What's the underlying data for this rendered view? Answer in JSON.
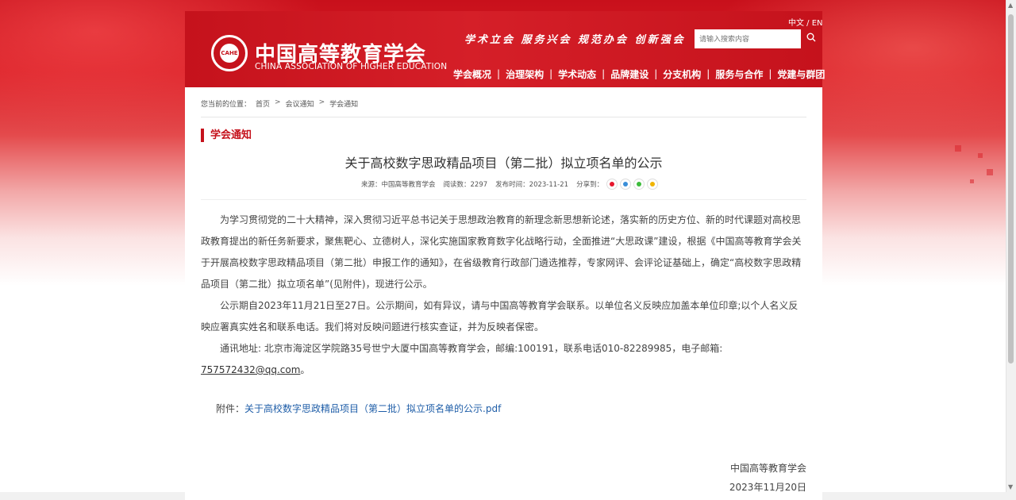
{
  "header": {
    "org_name_cn": "中国高等教育学会",
    "org_name_en": "CHINA ASSOCIATION OF HIGHER EDUCATION",
    "logo_text": "CAHE",
    "language_switch": "中文 / EN",
    "slogan": "学术立会 服务兴会 规范办会 创新强会",
    "search_placeholder": "请输入搜索内容",
    "nav": [
      "学会概况",
      "治理架构",
      "学术动态",
      "品牌建设",
      "分支机构",
      "服务与合作",
      "党建与群团"
    ]
  },
  "breadcrumb": {
    "label": "您当前的位置：",
    "items": [
      "首页",
      "会议通知",
      "学会通知"
    ]
  },
  "section_title": "学会通知",
  "article": {
    "title": "关于高校数字思政精品项目（第二批）拟立项名单的公示",
    "meta": {
      "source": "来源：中国高等教育学会",
      "views": "阅读数：2297",
      "date": "发布时间：2023-11-21",
      "share_label": "分享到："
    },
    "share_icons": [
      "weibo-icon",
      "qzone-icon",
      "wechat-icon",
      "favorite-icon"
    ],
    "paragraphs": [
      "为学习贯彻党的二十大精神，深入贯彻习近平总书记关于思想政治教育的新理念新思想新论述，落实新的历史方位、新的时代课题对高校思政教育提出的新任务新要求，聚焦靶心、立德树人，深化实施国家教育数字化战略行动，全面推进“大思政课”建设，根据《中国高等教育学会关于开展高校数字思政精品项目（第二批）申报工作的通知》，在省级教育行政部门遴选推荐，专家网评、会评论证基础上，确定“高校数字思政精品项目（第二批）拟立项名单”(见附件)，现进行公示。",
      "公示期自2023年11月21日至27日。公示期间，如有异议，请与中国高等教育学会联系。以单位名义反映应加盖本单位印章;以个人名义反映应署真实姓名和联系电话。我们将对反映问题进行核实查证，并为反映者保密。"
    ],
    "contact_text": "通讯地址: 北京市海淀区学院路35号世宁大厦中国高等教育学会，邮编:100191，联系电话010-82289985，电子邮箱: ",
    "email": "757572432@qq.com",
    "contact_end": "。",
    "attachment_label": "附件：",
    "attachment_link": "关于高校数字思政精品项目（第二批）拟立项名单的公示.pdf",
    "signoff_org": "中国高等教育学会",
    "signoff_date": "2023年11月20日"
  }
}
